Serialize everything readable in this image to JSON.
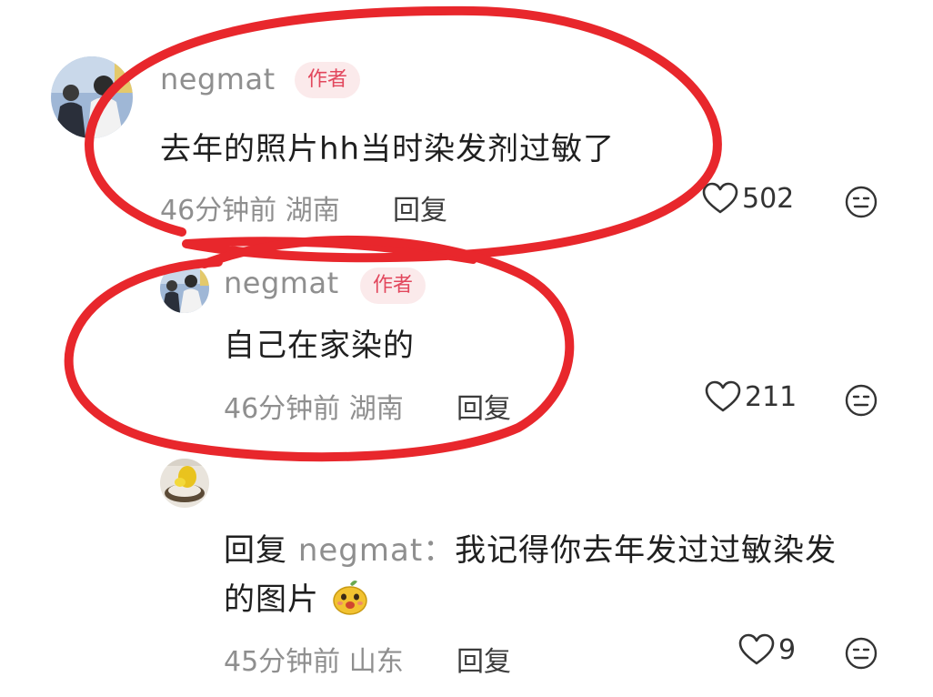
{
  "comments": [
    {
      "username": "negmat",
      "badge": "作者",
      "text": "去年的照片hh当时染发剂过敏了",
      "meta": "46分钟前 湖南",
      "reply_label": "回复",
      "likes": "502"
    },
    {
      "username": "negmat",
      "badge": "作者",
      "text": "自己在家染的",
      "meta": "46分钟前 湖南",
      "reply_label": "回复",
      "likes": "211"
    },
    {
      "username": "",
      "reply_prefix": "回复",
      "reply_target": "negmat：",
      "text_line1": "我记得你去年发过过敏染发",
      "text_line2": "的图片",
      "meta": "45分钟前 山东",
      "reply_label": "回复",
      "likes": "9"
    }
  ],
  "icons": {
    "like": "heart-outline-icon",
    "emoji_button": "neutral-face-icon",
    "inline_emoji": "yellow-face-emoji"
  },
  "colors": {
    "annotation": "#e8272c",
    "badge_text": "#e2475d",
    "badge_bg": "#fbeaeb",
    "secondary_text": "#8f8f8f"
  }
}
